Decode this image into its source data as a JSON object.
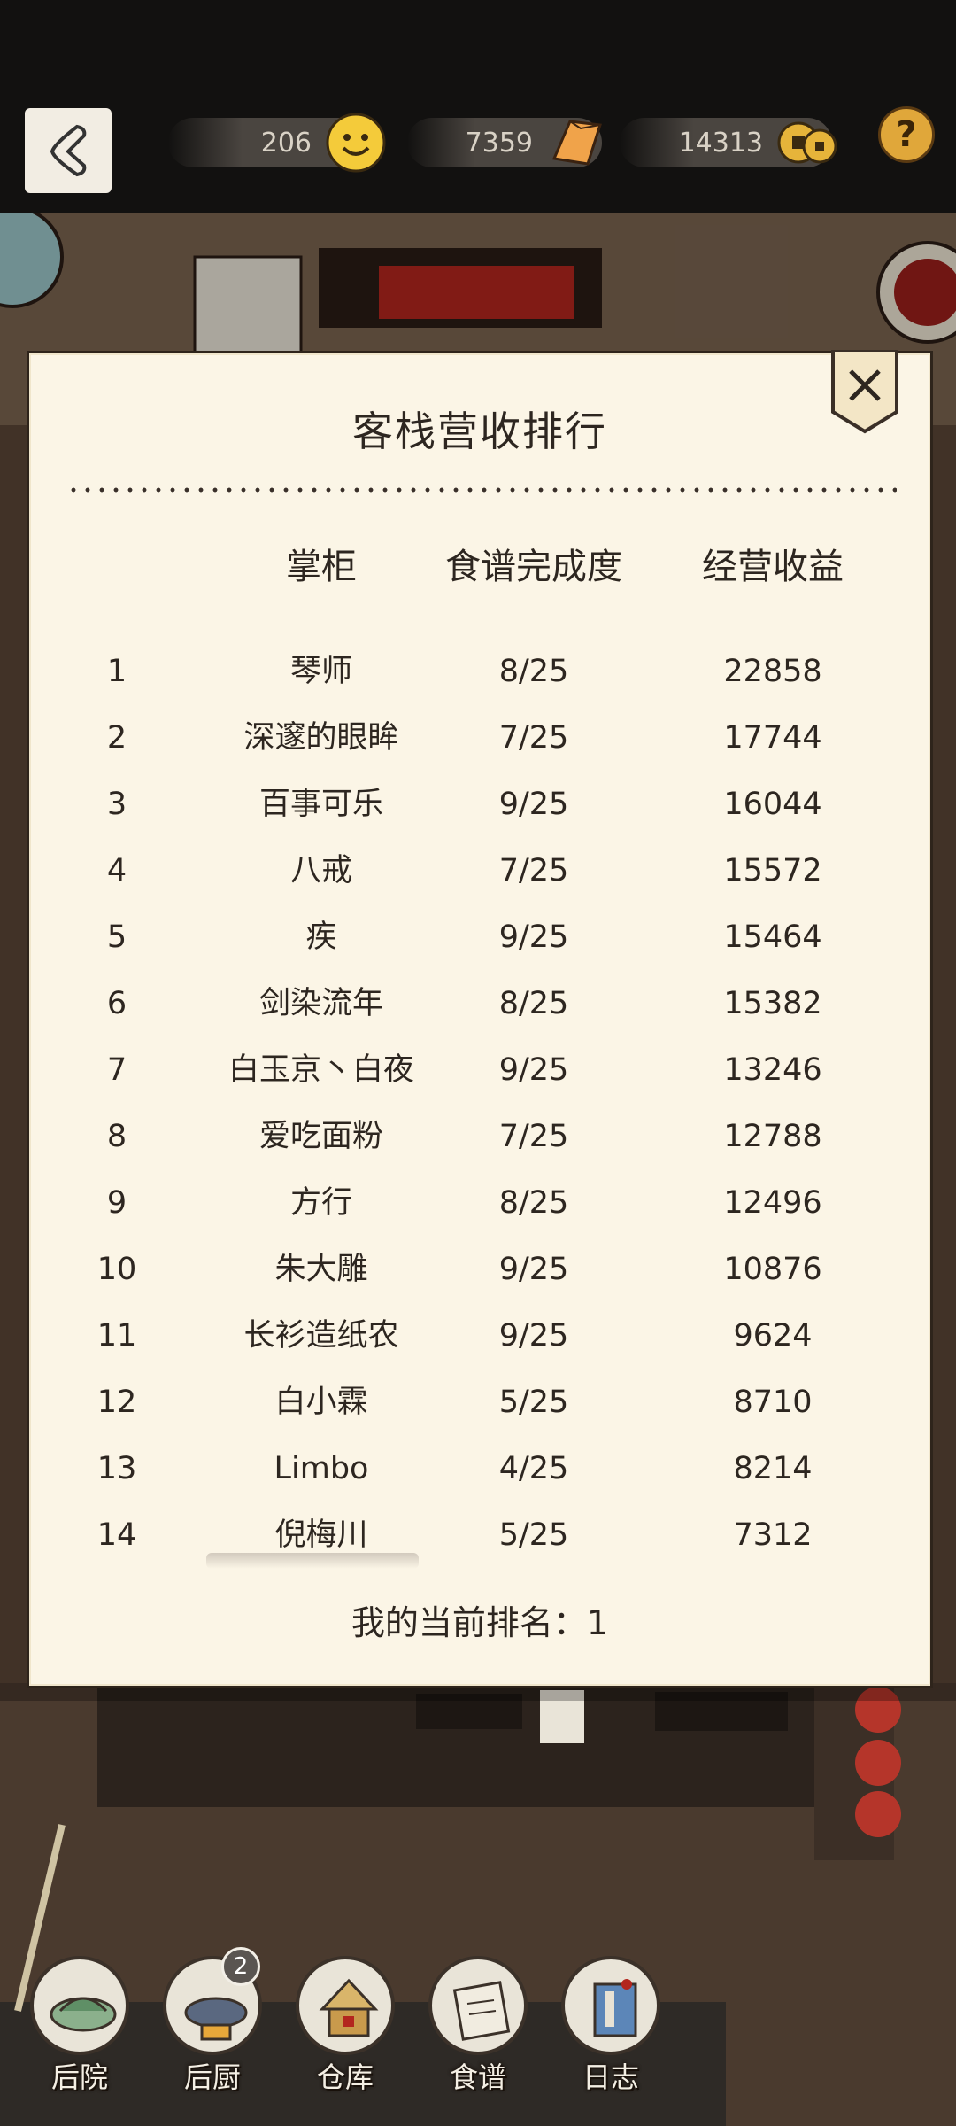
{
  "topbar": {
    "resources": [
      {
        "name": "reputation",
        "value": "206",
        "icon": "smiley-icon"
      },
      {
        "name": "gold",
        "value": "7359",
        "icon": "gold-bar-icon"
      },
      {
        "name": "coins",
        "value": "14313",
        "icon": "copper-coins-icon"
      }
    ],
    "help_label": "?"
  },
  "modal": {
    "title": "客栈营收排行",
    "headers": {
      "name": "掌柜",
      "recipe": "食谱完成度",
      "income": "经营收益"
    },
    "rows": [
      {
        "rank": "1",
        "name": "琴师",
        "recipe": "8/25",
        "income": "22858"
      },
      {
        "rank": "2",
        "name": "深邃的眼眸",
        "recipe": "7/25",
        "income": "17744"
      },
      {
        "rank": "3",
        "name": "百事可乐",
        "recipe": "9/25",
        "income": "16044"
      },
      {
        "rank": "4",
        "name": "八戒",
        "recipe": "7/25",
        "income": "15572"
      },
      {
        "rank": "5",
        "name": "疾",
        "recipe": "9/25",
        "income": "15464"
      },
      {
        "rank": "6",
        "name": "剑染流年",
        "recipe": "8/25",
        "income": "15382"
      },
      {
        "rank": "7",
        "name": "白玉京丶白夜",
        "recipe": "9/25",
        "income": "13246"
      },
      {
        "rank": "8",
        "name": "爱吃面粉",
        "recipe": "7/25",
        "income": "12788"
      },
      {
        "rank": "9",
        "name": "方行",
        "recipe": "8/25",
        "income": "12496"
      },
      {
        "rank": "10",
        "name": "朱大雕",
        "recipe": "9/25",
        "income": "10876"
      },
      {
        "rank": "11",
        "name": "长衫造纸农",
        "recipe": "9/25",
        "income": "9624"
      },
      {
        "rank": "12",
        "name": "白小霖",
        "recipe": "5/25",
        "income": "8710"
      },
      {
        "rank": "13",
        "name": "Limbo",
        "recipe": "4/25",
        "income": "8214"
      },
      {
        "rank": "14",
        "name": "倪梅川",
        "recipe": "5/25",
        "income": "7312"
      }
    ],
    "my_rank": "我的当前排名：1"
  },
  "nav": [
    {
      "label": "后院",
      "icon": "courtyard-icon"
    },
    {
      "label": "后厨",
      "icon": "kitchen-wok-icon",
      "badge": "2"
    },
    {
      "label": "仓库",
      "icon": "warehouse-icon"
    },
    {
      "label": "食谱",
      "icon": "recipe-book-icon"
    },
    {
      "label": "日志",
      "icon": "log-book-icon"
    }
  ],
  "colors": {
    "panel": "#fbf5e6",
    "text": "#2d2620",
    "topbar": "#121110",
    "accent": "#e0a73a"
  }
}
